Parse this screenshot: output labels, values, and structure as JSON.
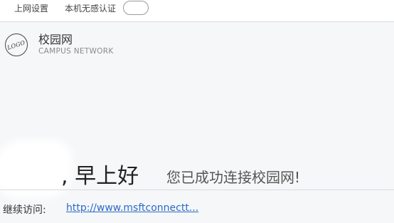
{
  "topbar": {
    "network_settings": "上网设置",
    "auto_auth_label": "本机无感认证",
    "auto_auth_enabled": false
  },
  "brand": {
    "logo_text": "LOGO",
    "name": "校园网",
    "subtitle": "CAMPUS NETWORK"
  },
  "main": {
    "greeting": ", 早上好",
    "success_message": "您已成功连接校园网!"
  },
  "footer": {
    "continue_label": "继续访问:",
    "continue_url": "http://www.msftconnectt..."
  },
  "colors": {
    "link": "#2a6bc7",
    "background": "#f6f7f9"
  }
}
